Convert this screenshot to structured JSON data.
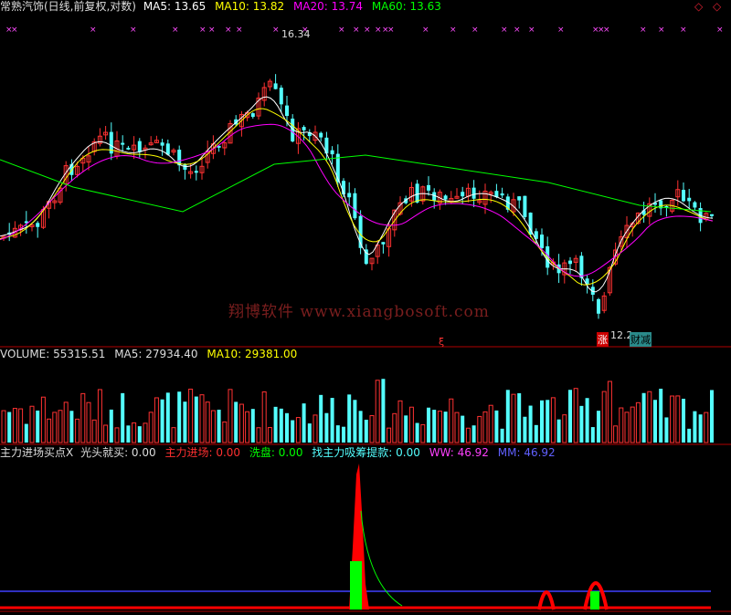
{
  "header": {
    "title": "常熟汽饰(日线,前复权,对数)",
    "ma5": "MA5: 13.65",
    "ma10": "MA10: 13.82",
    "ma20": "MA20: 13.74",
    "ma60": "MA60: 13.63"
  },
  "controls": {
    "left_arrow": "◇",
    "right_arrow": "◇"
  },
  "price_panel": {
    "high_label": "16.34",
    "low_label": "12.2",
    "marker_red": "涨",
    "marker_cyan": "财减",
    "marker_left": "ξ"
  },
  "volume_panel": {
    "label": "VOLUME: 55315.51",
    "ma5": "MA5: 27934.40",
    "ma10": "MA10: 29381.00"
  },
  "indicator_panel": {
    "name": "主力进场买点X",
    "item1": "光头就买: 0.00",
    "item2": "主力进场: 0.00",
    "item3": "洗盘: 0.00",
    "item4": "找主力吸筹提款: 0.00",
    "item5": "WW: 46.92",
    "item6": "MM: 46.92"
  },
  "watermark": "翔博软件 www.xiangbosoft.com",
  "colors": {
    "up": "#ff3232",
    "down": "#54ffff",
    "ma5": "#ffffff",
    "ma10": "#ffff00",
    "ma20": "#ff00ff",
    "ma60": "#00ff00",
    "grid": "#b00000",
    "indicator_red": "#ff0000",
    "indicator_green": "#00ff00",
    "indicator_blue": "#4040ff"
  }
}
